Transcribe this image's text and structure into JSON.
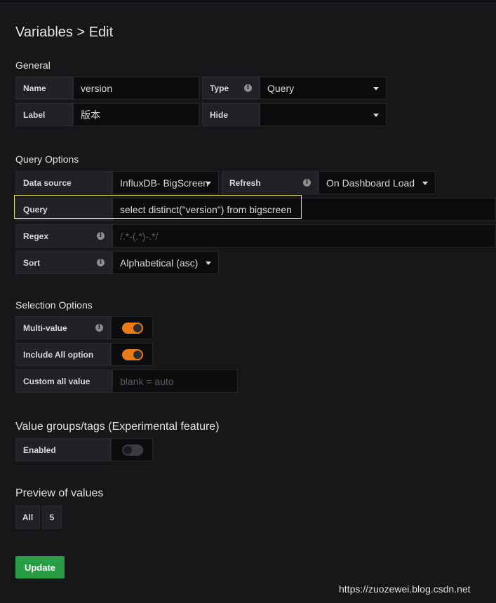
{
  "page": {
    "title": "Variables > Edit"
  },
  "general": {
    "title": "General",
    "name_label": "Name",
    "name_value": "version",
    "type_label": "Type",
    "type_value": "Query",
    "label_label": "Label",
    "label_value": "版本",
    "hide_label": "Hide",
    "hide_value": ""
  },
  "query_options": {
    "title": "Query Options",
    "datasource_label": "Data source",
    "datasource_value": "InfluxDB- BigScreen",
    "refresh_label": "Refresh",
    "refresh_value": "On Dashboard Load",
    "query_label": "Query",
    "query_value": "select distinct(\"version\") from bigscreen",
    "regex_label": "Regex",
    "regex_placeholder": "/.*-(.*)-.*/",
    "sort_label": "Sort",
    "sort_value": "Alphabetical (asc)"
  },
  "selection_options": {
    "title": "Selection Options",
    "multi_label": "Multi-value",
    "multi_on": true,
    "include_all_label": "Include All option",
    "include_all_on": true,
    "custom_all_label": "Custom all value",
    "custom_all_placeholder": "blank = auto"
  },
  "value_groups": {
    "title": "Value groups/tags (Experimental feature)",
    "enabled_label": "Enabled",
    "enabled_on": false
  },
  "preview": {
    "title": "Preview of values",
    "values": [
      "All",
      "5"
    ]
  },
  "actions": {
    "update_label": "Update"
  },
  "watermark": "https://zuozewei.blog.csdn.net",
  "colors": {
    "accent": "#eb7b18",
    "update": "#299c46",
    "highlight": "#e6e64c"
  }
}
